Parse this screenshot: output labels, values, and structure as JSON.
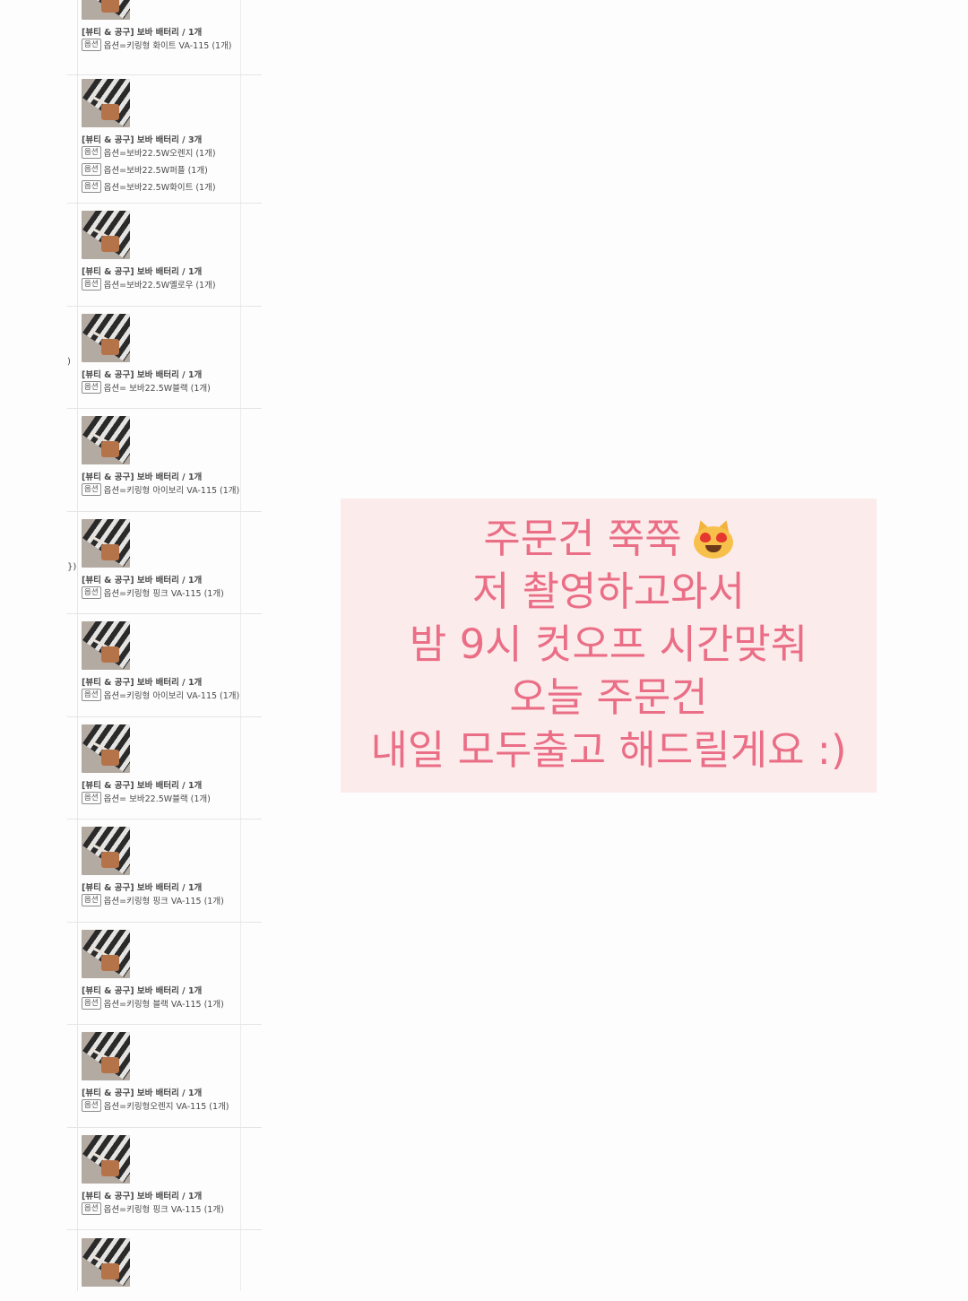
{
  "side_marks": [
    ")",
    "})"
  ],
  "orders": [
    {
      "title": "[뷰티 & 공구] 보바 배터리 / 1개",
      "options": [
        "옵션=키링형 화이트 VA-115 (1개)"
      ]
    },
    {
      "title": "[뷰티 & 공구] 보바 배터리 / 3개",
      "options": [
        "옵션=보바22.5W오렌지 (1개)",
        "옵션=보바22.5W퍼플 (1개)",
        "옵션=보바22.5W화이트 (1개)"
      ]
    },
    {
      "title": "[뷰티 & 공구] 보바 배터리 / 1개",
      "options": [
        "옵션=보바22.5W옐로우 (1개)"
      ]
    },
    {
      "title": "[뷰티 & 공구] 보바 배터리 / 1개",
      "options": [
        "옵션= 보바22.5W블랙 (1개)"
      ]
    },
    {
      "title": "[뷰티 & 공구] 보바 배터리 / 1개",
      "options": [
        "옵션=키링형 아이보리 VA-115 (1개)"
      ]
    },
    {
      "title": "[뷰티 & 공구] 보바 배터리 / 1개",
      "options": [
        "옵션=키링형 핑크 VA-115 (1개)"
      ]
    },
    {
      "title": "[뷰티 & 공구] 보바 배터리 / 1개",
      "options": [
        "옵션=키링형 아이보리 VA-115 (1개)"
      ]
    },
    {
      "title": "[뷰티 & 공구] 보바 배터리 / 1개",
      "options": [
        "옵션= 보바22.5W블랙 (1개)"
      ]
    },
    {
      "title": "[뷰티 & 공구] 보바 배터리 / 1개",
      "options": [
        "옵션=키링형 핑크 VA-115 (1개)"
      ]
    },
    {
      "title": "[뷰티 & 공구] 보바 배터리 / 1개",
      "options": [
        "옵션=키링형 블랙 VA-115 (1개)"
      ]
    },
    {
      "title": "[뷰티 & 공구] 보바 배터리 / 1개",
      "options": [
        "옵션=키링형오렌지 VA-115 (1개)"
      ]
    },
    {
      "title": "[뷰티 & 공구] 보바 배터리 / 1개",
      "options": [
        "옵션=키링형 핑크 VA-115 (1개)"
      ]
    },
    {
      "title": "",
      "options": []
    }
  ],
  "option_badge": "옵션",
  "caption": {
    "lines": [
      "주문건 쭉쭉",
      "저 촬영하고와서",
      "밤 9시 컷오프 시간맞춰",
      "오늘 주문건",
      "내일 모두출고 해드릴게요 :)"
    ],
    "emoji": "heart-eyes-cat-icon",
    "color": "#ea6e86",
    "background": "#fcebeb"
  }
}
